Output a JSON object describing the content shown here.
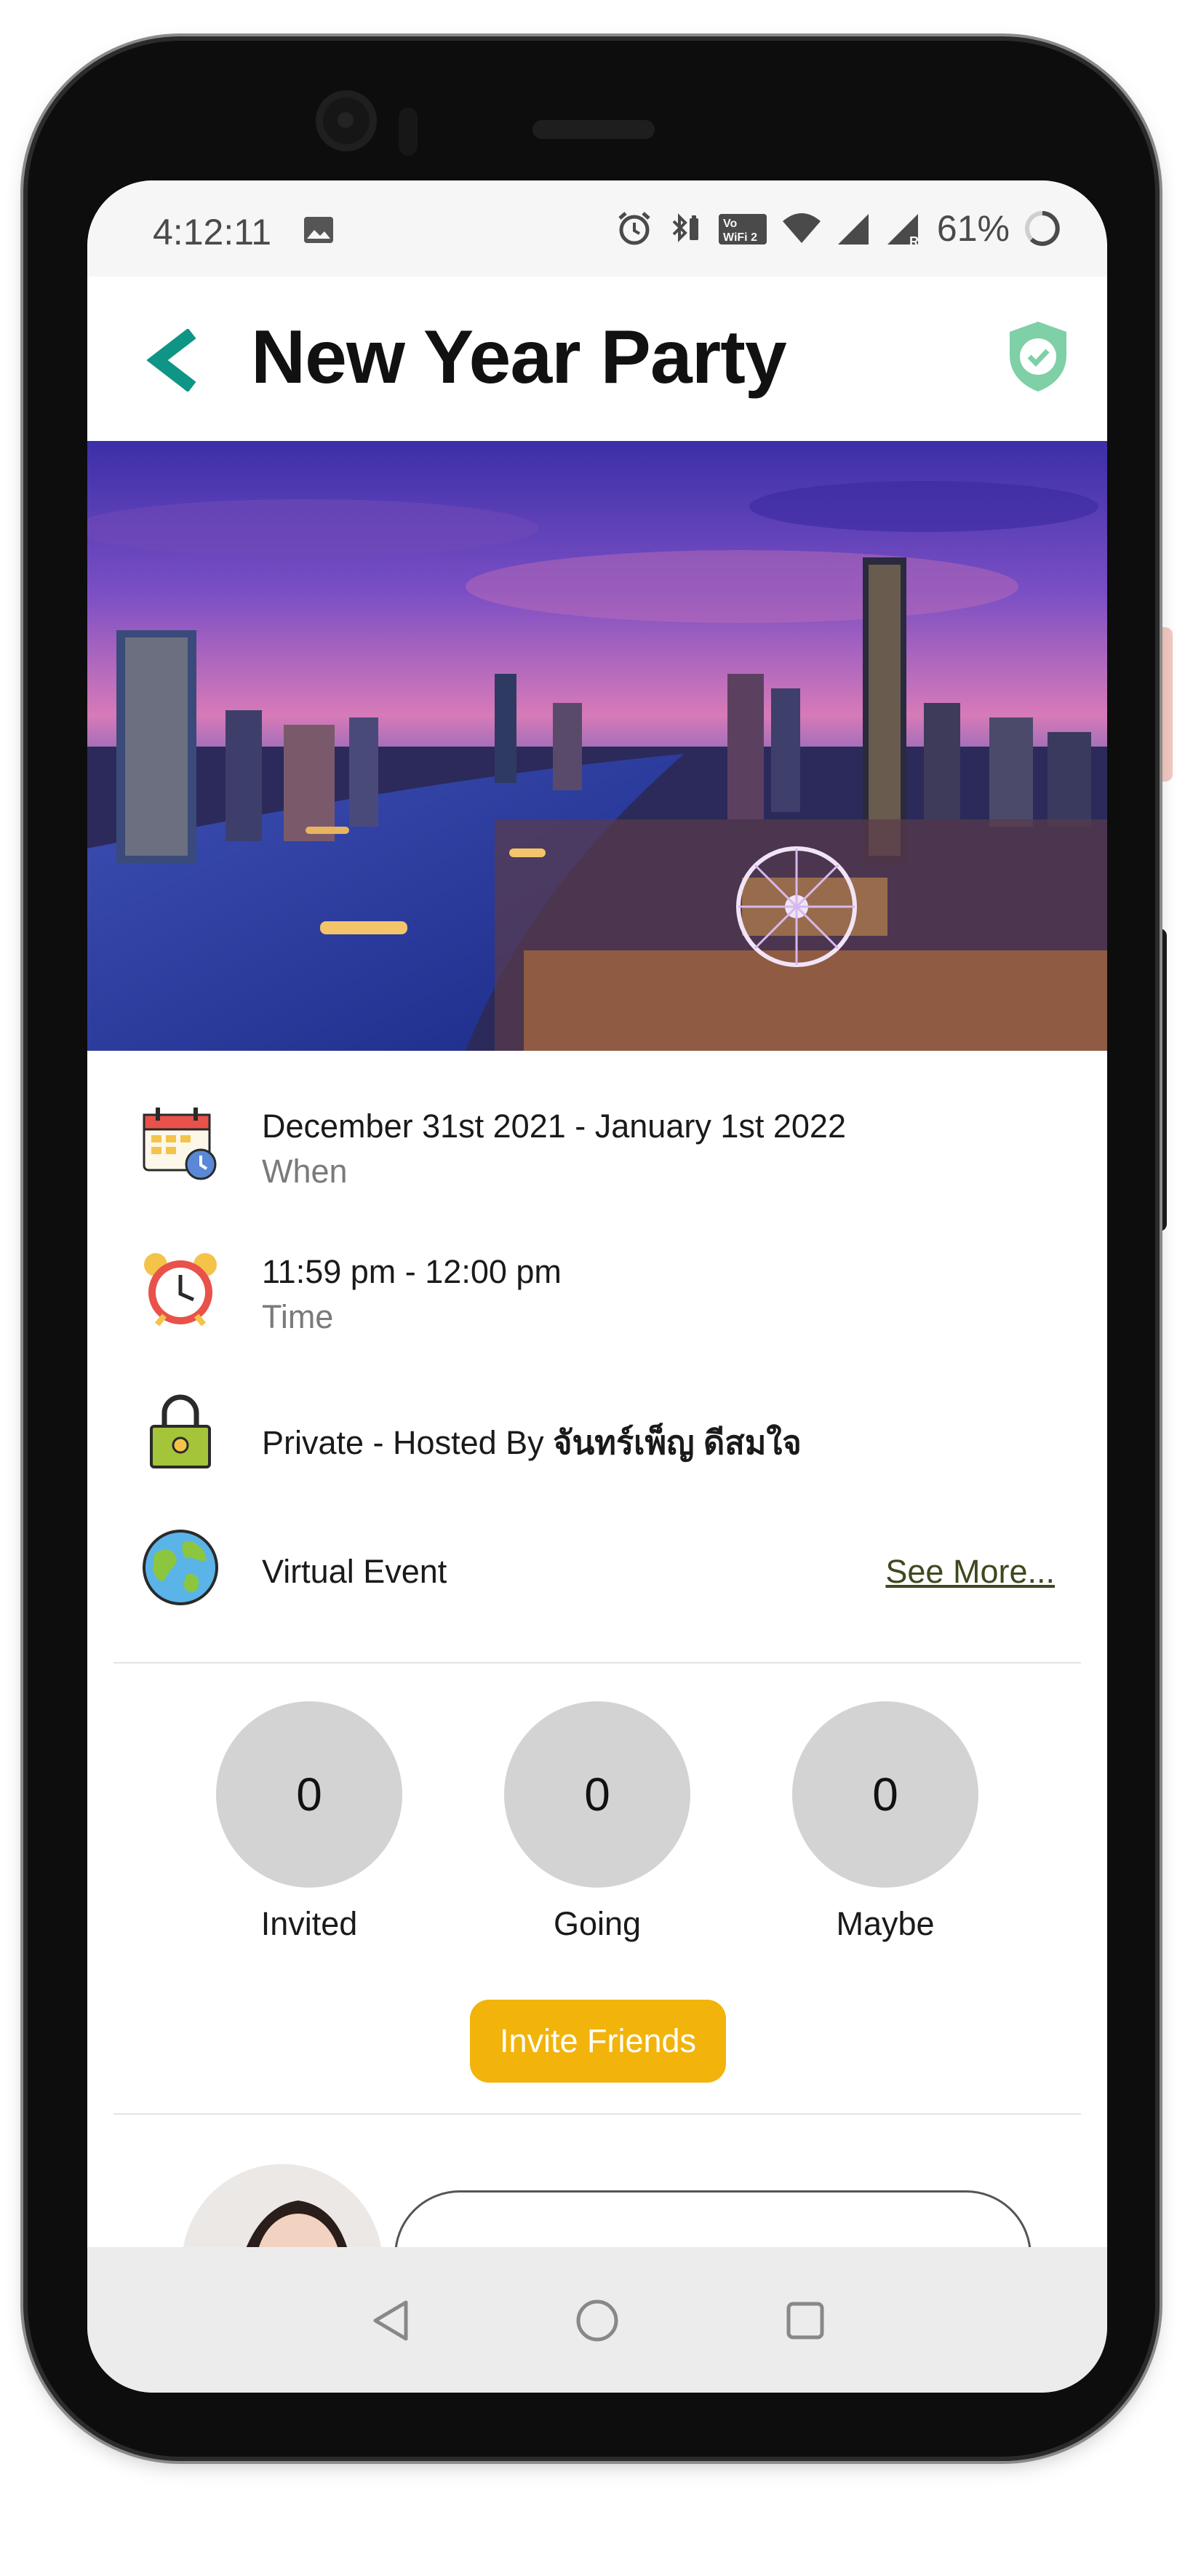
{
  "status_bar": {
    "time": "4:12:11",
    "battery": "61%",
    "icons": [
      "image-icon",
      "alarm-icon",
      "bluetooth-battery-icon",
      "volte-wifi-icon",
      "wifi-icon",
      "signal-icon",
      "signal-roaming-icon",
      "battery-ring-icon"
    ]
  },
  "header": {
    "title": "New Year Party",
    "back_icon": "chevron-left-icon",
    "badge_icon": "shield-check-icon"
  },
  "colors": {
    "accent_teal": "#0e9585",
    "shield_green": "#7fcfa7",
    "invite_button": "#f2b30b",
    "counter_circle": "#d3d3d3",
    "see_more_link": "#3d4a1f"
  },
  "event": {
    "when": {
      "value": "December 31st 2021 - January 1st 2022",
      "label": "When",
      "icon": "calendar-icon"
    },
    "time": {
      "value": "11:59 pm - 12:00 pm",
      "label": "Time",
      "icon": "alarm-clock-icon"
    },
    "privacy": {
      "prefix": "Private - Hosted By",
      "host": "จันทร์เพ็ญ ดีสมใจ",
      "icon": "padlock-icon"
    },
    "location": {
      "value": "Virtual Event",
      "link": "See More...",
      "icon": "globe-icon"
    }
  },
  "rsvp": [
    {
      "count": "0",
      "label": "Invited"
    },
    {
      "count": "0",
      "label": "Going"
    },
    {
      "count": "0",
      "label": "Maybe"
    }
  ],
  "invite_button": "Invite Friends",
  "nav": [
    "back-triangle-icon",
    "home-circle-icon",
    "recents-square-icon"
  ]
}
